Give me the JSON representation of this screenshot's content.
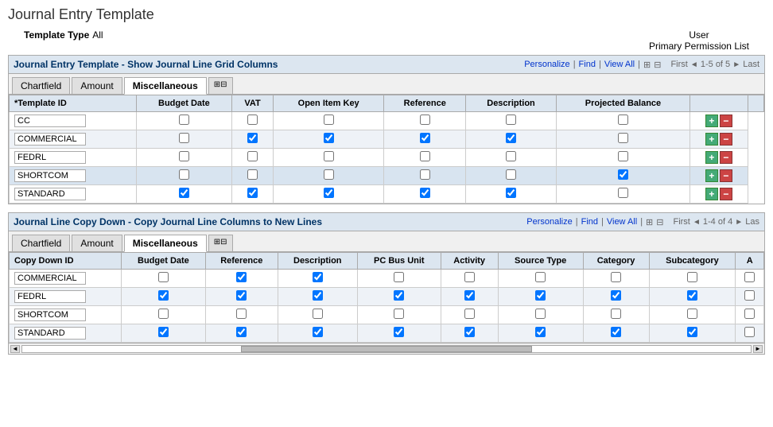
{
  "page": {
    "title": "Journal Entry Template",
    "template_type_label": "Template Type",
    "template_type_value": "All",
    "user_label": "User",
    "permission_label": "Primary Permission List"
  },
  "section1": {
    "title": "Journal Entry Template - Show Journal Line Grid Columns",
    "personalize": "Personalize",
    "find": "Find",
    "view_all": "View All",
    "pagination": "First",
    "page_info": "1-5 of 5",
    "last": "Last",
    "tabs": [
      "Chartfield",
      "Amount",
      "Miscellaneous"
    ],
    "columns": [
      "*Template ID",
      "Budget Date",
      "VAT",
      "Open Item Key",
      "Reference",
      "Description",
      "Projected Balance"
    ],
    "rows": [
      {
        "id": "CC",
        "budget_date": false,
        "vat": false,
        "open_item_key": false,
        "reference": false,
        "description": false,
        "projected_balance": false,
        "highlighted": false
      },
      {
        "id": "COMMERCIAL",
        "budget_date": false,
        "vat": true,
        "open_item_key": true,
        "reference": true,
        "description": true,
        "projected_balance": false,
        "highlighted": false
      },
      {
        "id": "FEDRL",
        "budget_date": false,
        "vat": false,
        "open_item_key": false,
        "reference": false,
        "description": false,
        "projected_balance": false,
        "highlighted": false
      },
      {
        "id": "SHORTCOM",
        "budget_date": false,
        "vat": false,
        "open_item_key": false,
        "reference": false,
        "description": false,
        "projected_balance": true,
        "highlighted": true
      },
      {
        "id": "STANDARD",
        "budget_date": true,
        "vat": true,
        "open_item_key": true,
        "reference": true,
        "description": true,
        "projected_balance": false,
        "highlighted": false
      }
    ]
  },
  "section2": {
    "title": "Journal Line Copy Down - Copy Journal Line Columns to New Lines",
    "personalize": "Personalize",
    "find": "Find",
    "view_all": "View All",
    "pagination": "First",
    "page_info": "1-4 of 4",
    "last": "Las",
    "tabs": [
      "Chartfield",
      "Amount",
      "Miscellaneous"
    ],
    "columns": [
      "Copy Down ID",
      "Budget Date",
      "Reference",
      "Description",
      "PC Bus Unit",
      "Activity",
      "Source Type",
      "Category",
      "Subcategory",
      "A"
    ],
    "rows": [
      {
        "id": "COMMERCIAL",
        "budget_date": false,
        "reference": true,
        "description": true,
        "pc_bus_unit": false,
        "activity": false,
        "source_type": false,
        "category": false,
        "subcategory": false
      },
      {
        "id": "FEDRL",
        "budget_date": true,
        "reference": true,
        "description": true,
        "pc_bus_unit": true,
        "activity": true,
        "source_type": true,
        "category": true,
        "subcategory": true
      },
      {
        "id": "SHORTCOM",
        "budget_date": false,
        "reference": false,
        "description": false,
        "pc_bus_unit": false,
        "activity": false,
        "source_type": false,
        "category": false,
        "subcategory": false
      },
      {
        "id": "STANDARD",
        "budget_date": true,
        "reference": true,
        "description": true,
        "pc_bus_unit": true,
        "activity": true,
        "source_type": true,
        "category": true,
        "subcategory": true
      }
    ]
  },
  "icons": {
    "add": "+",
    "remove": "−",
    "grid": "⊞",
    "nav_left": "◄",
    "nav_right": "►",
    "scroll_left": "◄",
    "scroll_right": "►"
  }
}
